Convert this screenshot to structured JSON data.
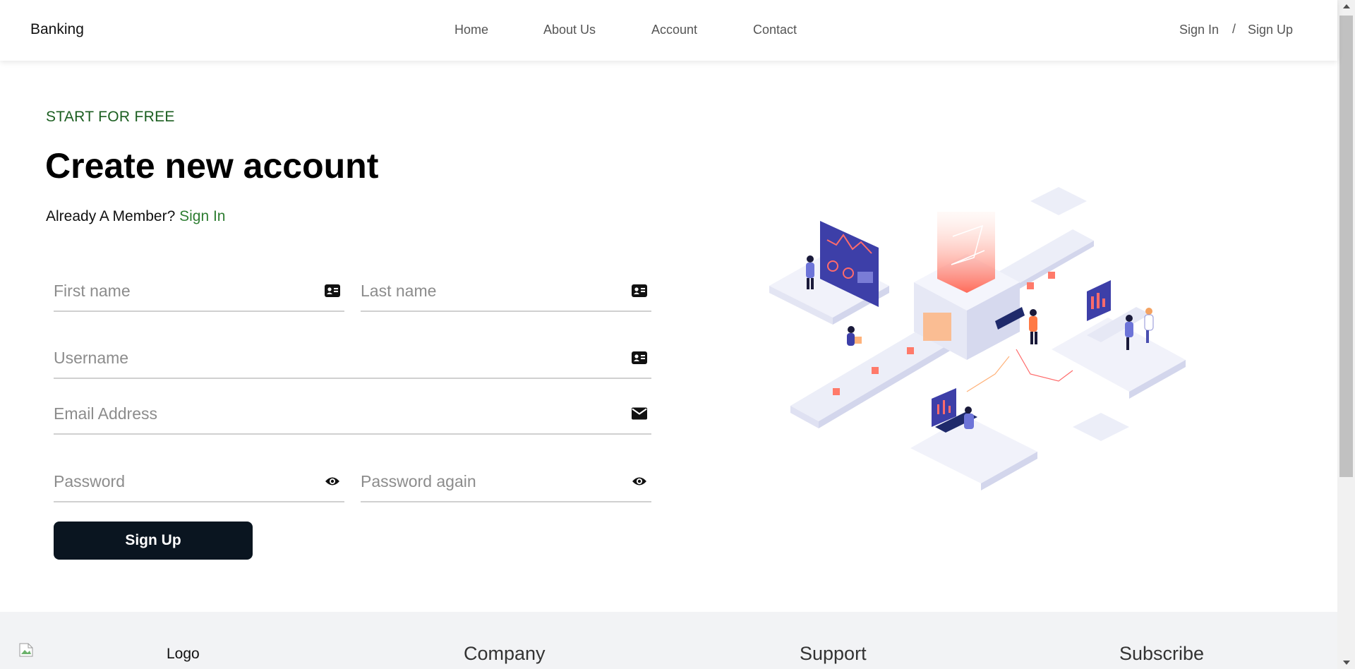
{
  "header": {
    "brand": "Banking",
    "nav": [
      "Home",
      "About Us",
      "Account",
      "Contact"
    ],
    "sign_in": "Sign In",
    "separator": "/",
    "sign_up": "Sign Up"
  },
  "main": {
    "eyebrow": "START FOR FREE",
    "title": "Create new account",
    "member_text": "Already A Member?",
    "member_link": "Sign In",
    "fields": {
      "first_name": {
        "placeholder": "First name",
        "value": "",
        "icon": "id-card-icon"
      },
      "last_name": {
        "placeholder": "Last name",
        "value": "",
        "icon": "id-card-icon"
      },
      "username": {
        "placeholder": "Username",
        "value": "",
        "icon": "id-card-icon"
      },
      "email": {
        "placeholder": "Email Address",
        "value": "",
        "icon": "envelope-icon"
      },
      "password": {
        "placeholder": "Password",
        "value": "",
        "icon": "eye-icon"
      },
      "password_again": {
        "placeholder": "Password again",
        "value": "",
        "icon": "eye-icon"
      }
    },
    "submit_label": "Sign Up"
  },
  "footer": {
    "logo": "Logo",
    "headings": [
      "Company",
      "Support",
      "Subscribe"
    ]
  },
  "colors": {
    "accent_green": "#2e7d32",
    "button_dark": "#0a1520",
    "footer_bg": "#f2f3f5"
  }
}
